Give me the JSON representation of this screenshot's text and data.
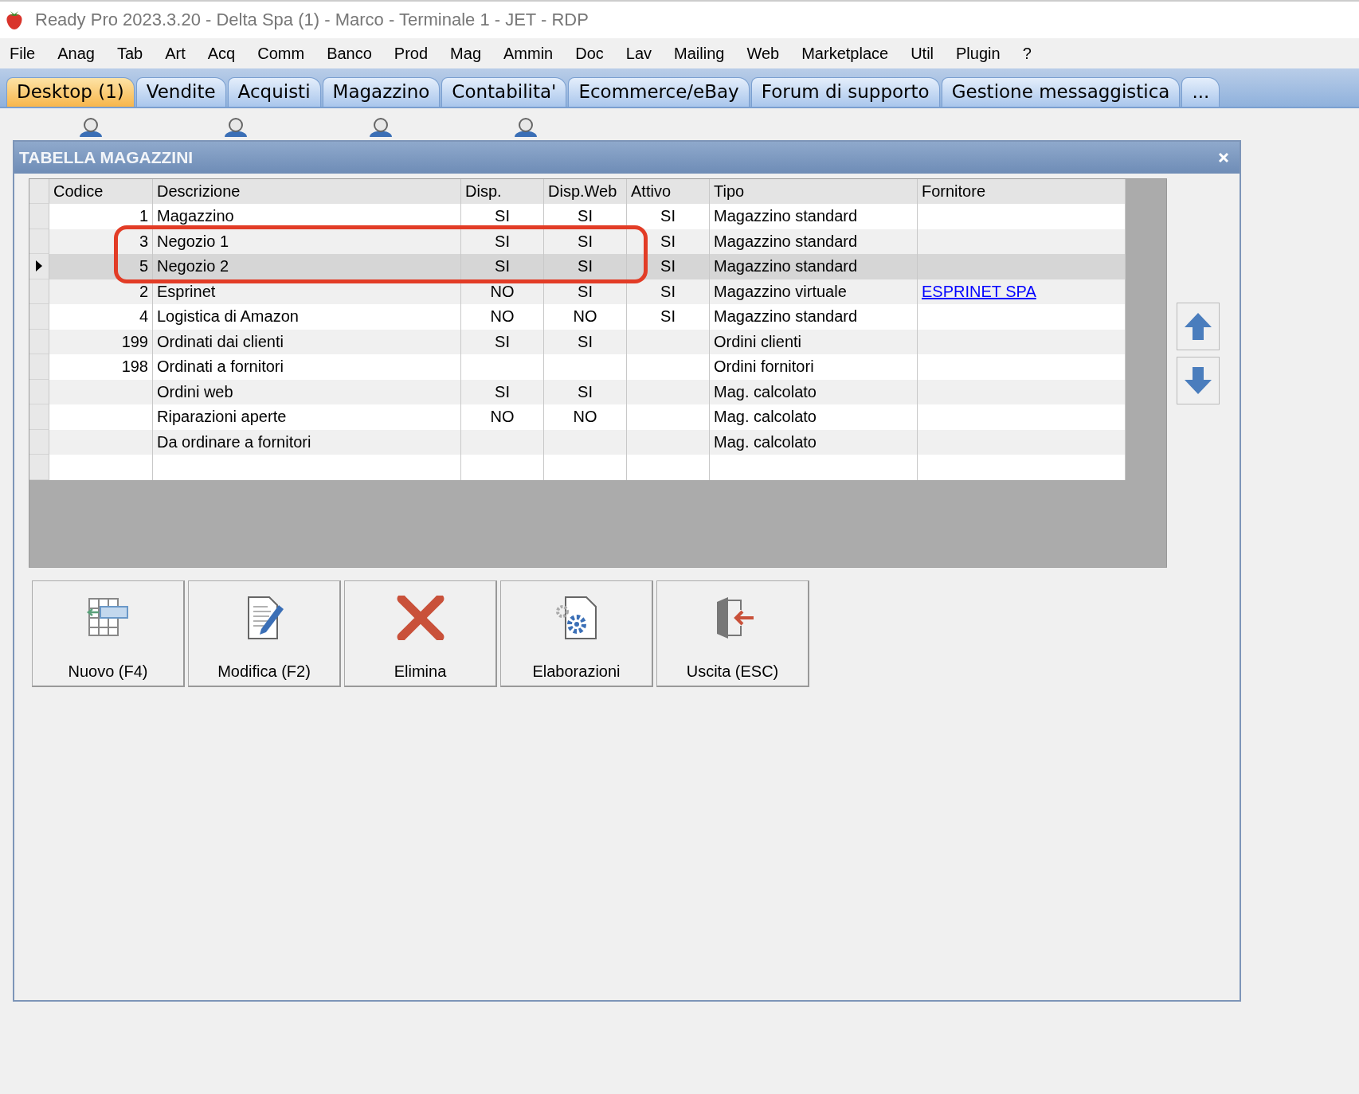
{
  "window": {
    "title": "Ready Pro 2023.3.20 - Delta Spa (1) - Marco - Terminale 1 - JET - RDP"
  },
  "menu": [
    "File",
    "Anag",
    "Tab",
    "Art",
    "Acq",
    "Comm",
    "Banco",
    "Prod",
    "Mag",
    "Ammin",
    "Doc",
    "Lav",
    "Mailing",
    "Web",
    "Marketplace",
    "Util",
    "Plugin",
    "?"
  ],
  "tabs": [
    {
      "label": "Desktop (1)",
      "selected": true
    },
    {
      "label": "Vendite",
      "selected": false
    },
    {
      "label": "Acquisti",
      "selected": false
    },
    {
      "label": "Magazzino",
      "selected": false
    },
    {
      "label": "Contabilita'",
      "selected": false
    },
    {
      "label": "Ecommerce/eBay",
      "selected": false
    },
    {
      "label": "Forum di supporto",
      "selected": false
    },
    {
      "label": "Gestione messaggistica",
      "selected": false
    },
    {
      "label": "...",
      "selected": false
    }
  ],
  "dialog": {
    "title": "TABELLA MAGAZZINI",
    "table": {
      "columns": [
        "Codice",
        "Descrizione",
        "Disp.",
        "Disp.Web",
        "Attivo",
        "Tipo",
        "Fornitore"
      ],
      "rows": [
        {
          "codice": "1",
          "descrizione": "Magazzino",
          "disp": "SI",
          "disp_web": "SI",
          "attivo": "SI",
          "tipo": "Magazzino standard",
          "selected": false,
          "highlighted": false
        },
        {
          "codice": "3",
          "descrizione": "Negozio 1",
          "disp": "SI",
          "disp_web": "SI",
          "attivo": "SI",
          "tipo": "Magazzino standard",
          "selected": false,
          "highlighted": true
        },
        {
          "codice": "5",
          "descrizione": "Negozio 2",
          "disp": "SI",
          "disp_web": "SI",
          "attivo": "SI",
          "tipo": "Magazzino standard",
          "selected": true,
          "highlighted": true
        },
        {
          "codice": "2",
          "descrizione": "Esprinet",
          "disp": "NO",
          "disp_web": "SI",
          "attivo": "SI",
          "tipo": "Magazzino virtuale",
          "fornitore": "ESPRINET SPA",
          "selected": false,
          "highlighted": false
        },
        {
          "codice": "4",
          "descrizione": "Logistica di Amazon",
          "disp": "NO",
          "disp_web": "NO",
          "attivo": "SI",
          "tipo": "Magazzino standard",
          "selected": false,
          "highlighted": false
        },
        {
          "codice": "199",
          "descrizione": "Ordinati dai clienti",
          "disp": "SI",
          "disp_web": "SI",
          "tipo": "Ordini clienti",
          "selected": false,
          "highlighted": false
        },
        {
          "codice": "198",
          "descrizione": "Ordinati a fornitori",
          "tipo": "Ordini fornitori",
          "selected": false,
          "highlighted": false
        },
        {
          "descrizione": "Ordini web",
          "disp": "SI",
          "disp_web": "SI",
          "tipo": "Mag. calcolato",
          "selected": false,
          "highlighted": false
        },
        {
          "descrizione": "Riparazioni aperte",
          "disp": "NO",
          "disp_web": "NO",
          "tipo": "Mag. calcolato",
          "selected": false,
          "highlighted": false
        },
        {
          "descrizione": "Da ordinare a fornitori",
          "tipo": "Mag. calcolato",
          "selected": false,
          "highlighted": false
        }
      ]
    },
    "buttons": [
      {
        "label": "Nuovo (F4)",
        "kind": "new"
      },
      {
        "label": "Modifica (F2)",
        "kind": "edit"
      },
      {
        "label": "Elimina",
        "kind": "delete"
      },
      {
        "label": "Elaborazioni",
        "kind": "process"
      },
      {
        "label": "Uscita (ESC)",
        "kind": "exit"
      }
    ]
  }
}
